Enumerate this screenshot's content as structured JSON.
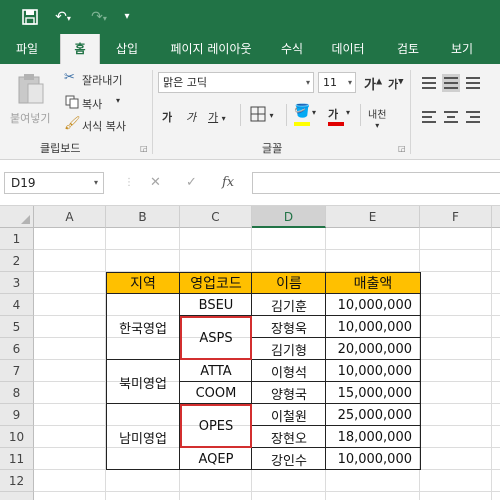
{
  "qat": {
    "save_icon": "save-icon",
    "undo_icon": "undo-icon",
    "redo_icon": "redo-icon",
    "customize_icon": "customize-qat-icon"
  },
  "tabs": [
    "파일",
    "홈",
    "삽입",
    "페이지 레이아웃",
    "수식",
    "데이터",
    "검토",
    "보기"
  ],
  "active_tab": "홈",
  "clipboard": {
    "paste": "붙여넣기",
    "cut": "잘라내기",
    "copy": "복사",
    "format_painter": "서식 복사",
    "label": "클립보드"
  },
  "font": {
    "name": "맑은 고딕",
    "size": "11",
    "grow": "가",
    "shrink": "가",
    "bold": "가",
    "italic": "가",
    "underline": "가",
    "font_color_glyph": "가",
    "phonetic": "내천",
    "label": "글꼴"
  },
  "formula_bar": {
    "name_box": "D19",
    "cancel": "✕",
    "enter": "✓",
    "fx": "fx",
    "formula": ""
  },
  "columns": [
    "A",
    "B",
    "C",
    "D",
    "E",
    "F"
  ],
  "selected_column": "D",
  "rows": [
    "1",
    "2",
    "3",
    "4",
    "5",
    "6",
    "7",
    "8",
    "9",
    "10",
    "11",
    "12"
  ],
  "table": {
    "headers": [
      "지역",
      "영업코드",
      "이름",
      "매출액"
    ],
    "regions": [
      "한국영업",
      "북미영업",
      "남미영업"
    ],
    "codes": [
      "BSEU",
      "ASPS",
      "ATTA",
      "COOM",
      "OPES",
      "AQEP"
    ],
    "names": [
      "김기훈",
      "장형욱",
      "김기형",
      "이형석",
      "양형국",
      "이철원",
      "장현오",
      "강인수"
    ],
    "sales": [
      "10,000,000",
      "10,000,000",
      "20,000,000",
      "10,000,000",
      "15,000,000",
      "25,000,000",
      "18,000,000",
      "10,000,000"
    ]
  },
  "colors": {
    "excel_green": "#217346",
    "header_fill": "#FFC000",
    "highlight_border": "#D32F2F"
  }
}
